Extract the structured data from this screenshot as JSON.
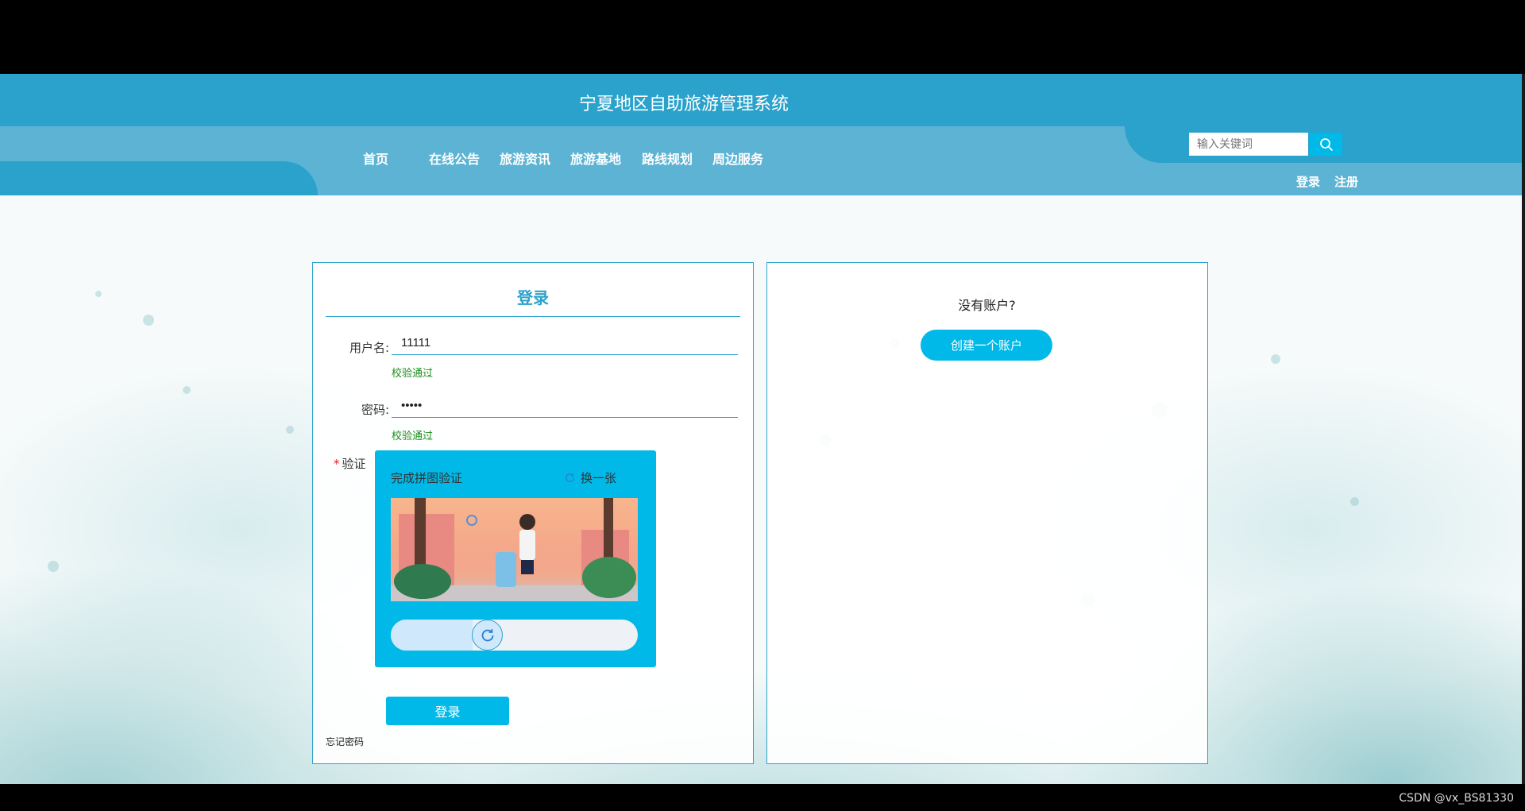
{
  "header": {
    "site_title": "宁夏地区自助旅游管理系统",
    "nav": [
      "首页",
      "在线公告",
      "旅游资讯",
      "旅游基地",
      "路线规划",
      "周边服务"
    ],
    "search_placeholder": "输入关键词",
    "login_link": "登录",
    "register_link": "注册"
  },
  "login_panel": {
    "title": "登录",
    "username_label": "用户名:",
    "username_value": "11111",
    "username_status": "校验通过",
    "password_label": "密码:",
    "password_value": "•••••",
    "password_status": "校验通过",
    "verify_star": "*",
    "verify_label": "验证",
    "captcha": {
      "hint": "完成拼图验证",
      "refresh_label": "换一张"
    },
    "submit_label": "登录",
    "forgot_label": "忘记密码"
  },
  "register_panel": {
    "question": "没有账户?",
    "create_label": "创建一个账户"
  },
  "watermark": "CSDN @vx_BS81330",
  "colors": {
    "header_dark": "#2ba2cc",
    "header_light": "#5cb3d4",
    "accent": "#00b9e8",
    "success": "#1c8f1c"
  }
}
